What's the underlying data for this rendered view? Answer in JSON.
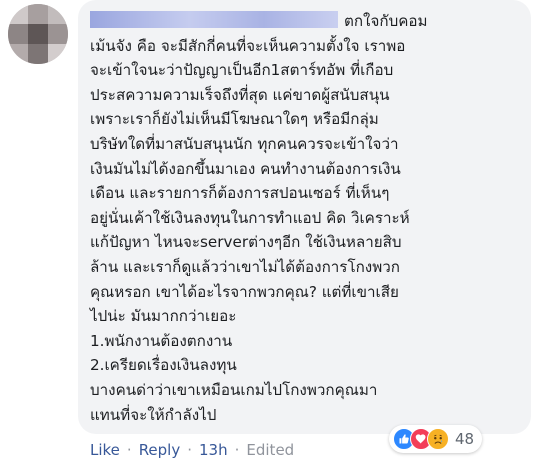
{
  "comment": {
    "lines": [
      "ตกใจกับคอม",
      "เม้นจัง คือ จะมีสักกี่คนที่จะเห็นความตั้งใจ เราพอ",
      "จะเข้าใจนะว่าปัญญาเป็นอีก1สตาร์ทอัพ ที่เกือบ",
      "ประสความความเร็จถึงที่สุด แค่ขาดผู้สนับสนุน",
      "เพราะเราก็ยังไม่เห็นมีโฆษณาใดๆ หรือมีกลุ่ม",
      "บริษัทใดที่มาสนับสนุนนัก ทุกคนควรจะเข้าใจว่า",
      "เงินมันไม่ได้งอกขึ้นมาเอง คนทำงานต้องการเงิน",
      "เดือน และรายการก็ต้องการสปอนเซอร์ ที่เห็นๆ",
      "อยู่นั่นเค้าใช้เงินลงทุนในการทำแอป คิด วิเคราะห์",
      "แก้ปัญหา ไหนจะserverต่างๆอีก ใช้เงินหลายสิบ",
      "ล้าน และเราก็ดูแล้วว่าเขาไม่ได้ต้องการโกงพวก",
      "คุณหรอก เขาได้อะไรจากพวกคุณ? แต่ที่เขาเสีย",
      "ไปน่ะ มันมากกว่าเยอะ",
      "1.พนักงานต้องตกงาน",
      "2.เครียดเรื่องเงินลงทุน",
      "บางคนด่าว่าเขาเหมือนเกมไปโกงพวกคุณมา",
      "แทนที่จะให้กำลังไป"
    ]
  },
  "actions": {
    "like": "Like",
    "reply": "Reply",
    "separator": "·",
    "time": "13h",
    "edited": "Edited"
  },
  "reactions": {
    "count": "48",
    "icons": [
      "like-icon",
      "love-icon",
      "sad-icon"
    ],
    "colors": {
      "like": "#2d88ff",
      "love": "#f33e58",
      "sad": "#f7b125"
    }
  },
  "colors": {
    "bubble": "#f2f3f5",
    "text": "#1c1e21",
    "link": "#385898",
    "meta": "#90949c"
  }
}
